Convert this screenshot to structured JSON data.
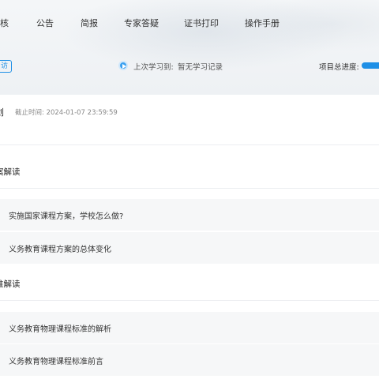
{
  "nav": {
    "items": [
      "核",
      "公告",
      "简报",
      "专家答疑",
      "证书打印",
      "操作手册"
    ]
  },
  "status": {
    "badge": "访",
    "last_study_label": "上次学习到:",
    "last_study_value": "暂无学习记录",
    "progress_label": "项目总进度:"
  },
  "course": {
    "title": "划",
    "deadline": "截止时间: 2024-01-07 23:59:59"
  },
  "sections": [
    {
      "title": "案解读",
      "lessons": [
        "实施国家课程方案，学校怎么做?",
        "义务教育课程方案的总体变化"
      ]
    },
    {
      "title": "准解读",
      "lessons": [
        "义务教育物理课程标准的解析",
        "义务教育物理课程标准前言"
      ]
    }
  ],
  "colors": {
    "accent": "#1e8fe6",
    "lesson_bg": "#f6f7f8"
  }
}
